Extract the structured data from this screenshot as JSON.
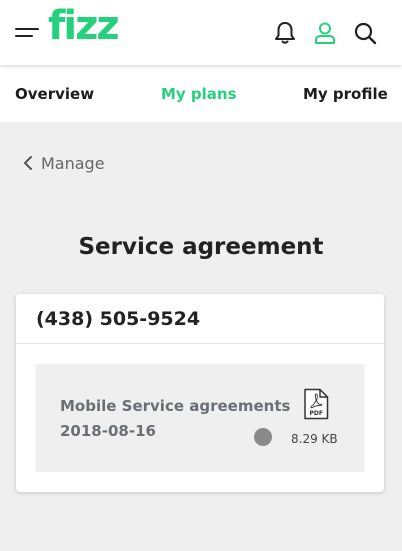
{
  "header": {
    "logo_text": "fizz",
    "brand_color": "#26d07c",
    "icons": [
      "menu-icon",
      "bell-icon",
      "user-icon",
      "search-icon"
    ]
  },
  "tabs": [
    {
      "label": "Overview",
      "active": false
    },
    {
      "label": "My plans",
      "active": true
    },
    {
      "label": "My profile",
      "active": false
    }
  ],
  "back_link": {
    "label": "Manage",
    "icon": "chevron-left-icon"
  },
  "page_title": "Service agreement",
  "card": {
    "phone_number": "(438) 505-9524",
    "document": {
      "name": "Mobile Service agreements",
      "date": "2018-08-16",
      "icon": "pdf-file-icon",
      "icon_label": "PDF",
      "size": "8.29 KB",
      "status_color": "#8a8a8a"
    }
  }
}
